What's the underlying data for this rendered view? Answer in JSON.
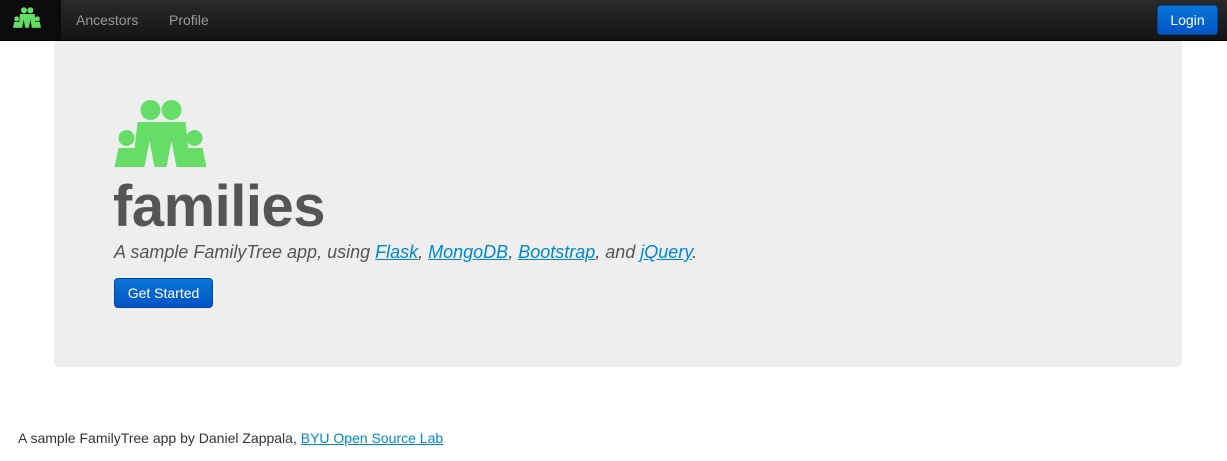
{
  "navbar": {
    "brand_icon": "family-icon",
    "items": [
      {
        "label": "Ancestors"
      },
      {
        "label": "Profile"
      }
    ],
    "login_label": "Login"
  },
  "hero": {
    "logo_icon": "family-icon",
    "title": "families",
    "tagline": {
      "prefix": "A sample FamilyTree app, using ",
      "link1": "Flask",
      "sep1": ", ",
      "link2": "MongoDB",
      "sep2": ", ",
      "link3": "Bootstrap",
      "sep3": ", and ",
      "link4": "jQuery",
      "suffix": "."
    },
    "button_label": "Get Started"
  },
  "footer": {
    "text": "A sample FamilyTree app by Daniel Zappala, ",
    "link": "BYU Open Source Lab"
  },
  "colors": {
    "logo_green": "#66dd66",
    "link_blue": "#0088cc",
    "button_blue": "#0066cc",
    "hero_bg": "#eeeeee",
    "navbar_bg": "#1b1b1b"
  }
}
